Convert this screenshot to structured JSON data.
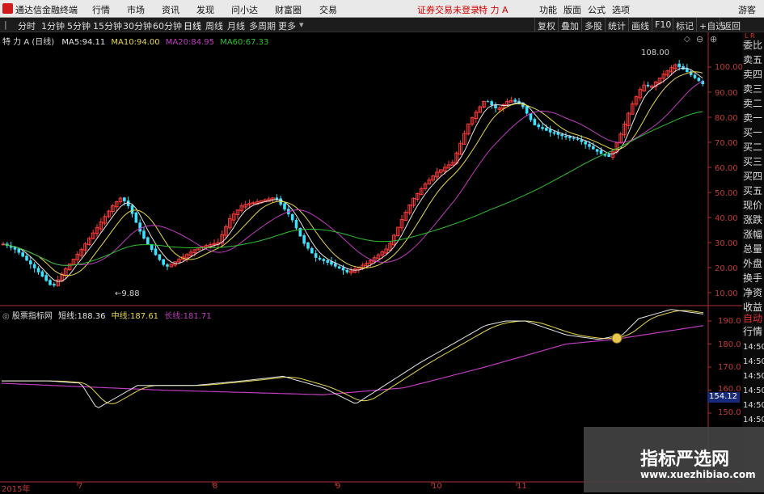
{
  "titlebar": {
    "app_name": "通达信金融终端",
    "menu": [
      "行情",
      "市场",
      "资讯",
      "发现",
      "问小达",
      "财富圈",
      "交易"
    ],
    "status": "证券交易未登录",
    "stock": "特 力 A",
    "right_menu": [
      "功能",
      "版面",
      "公式",
      "选项"
    ],
    "guest": "游客"
  },
  "toolbar": {
    "periods": [
      "分时",
      "1分钟",
      "5分钟",
      "15分钟",
      "30分钟",
      "60分钟",
      "日线",
      "周线",
      "月线",
      "多周期",
      "更多"
    ],
    "active_period": "日线",
    "right_buttons": [
      "复权",
      "叠加",
      "多股",
      "统计",
      "画线",
      "F10",
      "标记",
      "+自选",
      "返回"
    ]
  },
  "main_chart": {
    "title": "特 力 A (日线)",
    "ma": [
      {
        "label": "MA5:",
        "value": "94.11",
        "color": "#e6e6e6"
      },
      {
        "label": "MA10:",
        "value": "94.00",
        "color": "#e8d84a"
      },
      {
        "label": "MA20:",
        "value": "84.95",
        "color": "#c03cc0"
      },
      {
        "label": "MA60:",
        "value": "67.33",
        "color": "#2ec02e"
      }
    ],
    "high_label": "108.00",
    "low_label": "9.88",
    "y_ticks": [
      "100.00",
      "90.00",
      "80.00",
      "70.00",
      "60.00",
      "50.00",
      "40.00",
      "30.00",
      "20.00",
      "10.00"
    ]
  },
  "indicator": {
    "name": "股票指标网",
    "lines": [
      {
        "label": "短线:",
        "value": "188.36",
        "color": "#e6e6e6"
      },
      {
        "label": "中线:",
        "value": "187.61",
        "color": "#e8d84a"
      },
      {
        "label": "长线:",
        "value": "181.71",
        "color": "#c03cc0"
      }
    ],
    "y_ticks": [
      "190.0",
      "180.0",
      "170.0",
      "160.0",
      "150.0"
    ],
    "current_value": "154.12"
  },
  "x_axis": [
    "2015年",
    "7",
    "8",
    "9",
    "10",
    "11"
  ],
  "right_panel": {
    "top_label": "L R",
    "items": [
      "委比",
      "卖五",
      "卖四",
      "卖三",
      "卖二",
      "卖一",
      "买一",
      "买二",
      "买三",
      "买四",
      "买五",
      "现价",
      "涨跌",
      "涨幅",
      "总量",
      "外盘",
      "换手",
      "净资",
      "收益"
    ],
    "bottom_items": [
      "自动",
      "行情",
      "14:50",
      "14:50",
      "14:50",
      "14:50",
      "14:50",
      "14:50"
    ]
  },
  "watermark": {
    "title": "指标严选网",
    "url": "www.xuezhibiao.com"
  },
  "colors": {
    "up": "#ff3a3a",
    "down": "#40e0ff",
    "axis": "#b03030",
    "grid": "#5a1a1a"
  }
}
